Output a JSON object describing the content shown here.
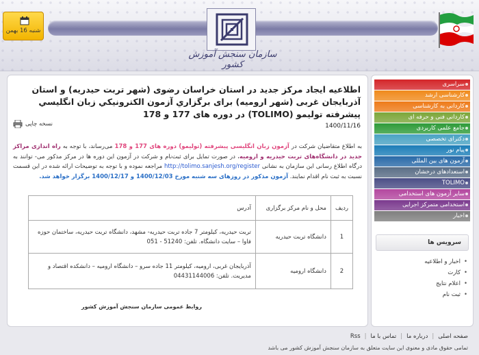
{
  "header": {
    "logo_text": "سازمان سنجش آموزش کشور",
    "date": "شنبه 16 بهمن"
  },
  "article": {
    "title": "اطلاعيه ايجاد مرکز جديد در استان خراسان رضوی (شهر تربت حيدريه) و استان آذربايجان غربی (شهر اروميه) برای برگزاري آزمون الكترونيكي زبان انگليسي پيشرفته توليمو (TOLIMO) در دوره های 177 و 178",
    "print_label": "نسخه چاپی",
    "date": "1400/11/16",
    "p1": "به اطلاع متقاضيان شرکت در ",
    "p2": "آزمون زبان انگليسی پيشرفته (توليمو) دوره های  177 و 178",
    "p3": " می‌رساند، با توجه به ",
    "p4": "راه اندازی مراکز جدید در دانشگاه‌های تربت حیدریه و ارومیه",
    "p5": "، در صورت تمایل برای ثبت‌نام و شرکت در آزمون این دوره ها در مرکز مذکور می- توانند به درگاه اطلاع رسانی این سازمان به نشانی ",
    "p6": "http://tolimo.sanjesh.org/register",
    "p7": " مراجعه نموده و با توجه به توضیحات ارائه شده در این قسمت نسبت به ثبت نام اقدام نمايند. ",
    "p8": "آزمون مذکور در روزهای سه شنبه مورخ 1400/12/03 و 1400/12/17 برگزار خواهد شد.",
    "table": {
      "headers": [
        "ردیف",
        "محل و نام مرکز برگزاری",
        "آدرس"
      ],
      "rows": [
        [
          "1",
          "دانشگاه تربت حیدریه",
          "تربت حیدریه، کیلومتر 7 جاده تربت حیدریه- مشهد، دانشگاه تربت حیدریه، ساختمان حوزه فاوا – سایت دانشگاه. تلفن: 51240 - 051"
        ],
        [
          "2",
          "دانشگاه ارومیه",
          "آذربایجان غربی، ارومیه، کیلومتر 11 جاده سرو – دانشگاه ارومیه – دانشکده اقتصاد و مدیریت. تلفن: 04431144006"
        ]
      ]
    },
    "signature": "روابط عمومی سازمان سنجش آموزش کشور"
  },
  "sidebar": {
    "menu": [
      {
        "label": "سراسری",
        "color": "#d4262a"
      },
      {
        "label": "کارشناسی ارشد",
        "color": "#f08a1c"
      },
      {
        "label": "کاردانی به کارشناسی",
        "color": "#ee7b1a"
      },
      {
        "label": "کاردانی فنی و حرفه ای",
        "color": "#7ca63a"
      },
      {
        "label": "جامع علمی کاربردی",
        "color": "#2f9b39"
      },
      {
        "label": "دکترای تخصصی",
        "color": "#4aa3c3"
      },
      {
        "label": "پیام نور",
        "color": "#1d7eb8"
      },
      {
        "label": "آزمون های بین المللی",
        "color": "#2a6aa8"
      },
      {
        "label": "استعدادهای درخشان",
        "color": "#5a6e86"
      },
      {
        "label": "TOLIMO",
        "color": "#4b4e86"
      },
      {
        "label": "سایر آزمون های استخدامی",
        "color": "#b3479f"
      },
      {
        "label": "استخدامی متمرکز اجرایی",
        "color": "#7b3a8e"
      },
      {
        "label": "اخبار",
        "color": "#7f7f7f"
      }
    ],
    "services_title": "سرویس ها",
    "services": [
      "اخبار و اطلاعیه",
      "کارت",
      "اعلام نتایج",
      "ثبت نام"
    ]
  },
  "footer": {
    "links": [
      "صفحه اصلی",
      "درباره ما",
      "تماس با ما",
      "Rss"
    ],
    "copyright": "تمامی حقوق مادی و معنوی این سایت متعلق به سازمان سنجش آموزش کشور می باشد"
  }
}
